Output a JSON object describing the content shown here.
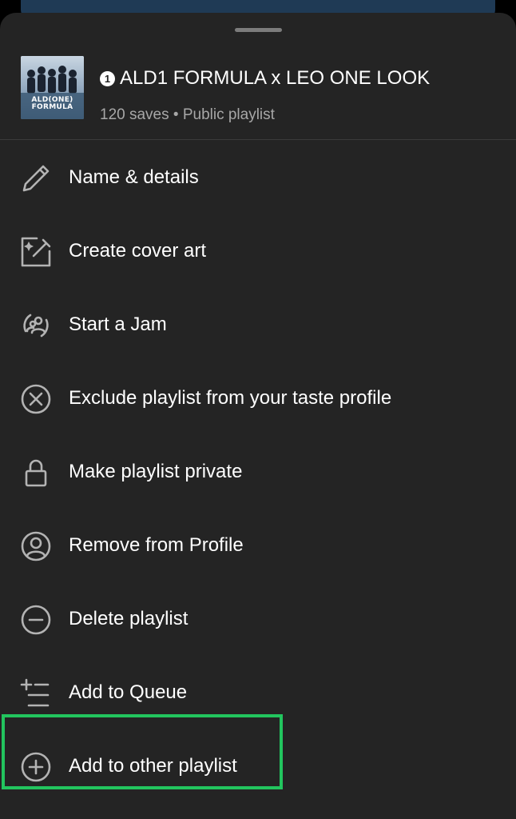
{
  "header": {
    "pin_glyph": "1",
    "title": "ALD1 FORMULA x LEO ONE LOOK",
    "subtitle": "120 saves • Public playlist",
    "cover_text_line1": "ALD(ONE)",
    "cover_text_line2": "FORMULA"
  },
  "menu": {
    "items": [
      {
        "label": "Name & details",
        "icon": "pencil-icon"
      },
      {
        "label": "Create cover art",
        "icon": "cover-art-icon"
      },
      {
        "label": "Start a Jam",
        "icon": "jam-icon"
      },
      {
        "label": "Exclude playlist from your taste profile",
        "icon": "exclude-icon"
      },
      {
        "label": "Make playlist private",
        "icon": "lock-icon"
      },
      {
        "label": "Remove from Profile",
        "icon": "profile-icon"
      },
      {
        "label": "Delete playlist",
        "icon": "minus-circle-icon"
      },
      {
        "label": "Add to Queue",
        "icon": "queue-icon"
      },
      {
        "label": "Add to other playlist",
        "icon": "plus-circle-icon"
      }
    ]
  },
  "colors": {
    "sheet_background": "#242424",
    "text_primary": "#ffffff",
    "text_secondary": "#a7a7a7",
    "highlight": "#22c55e"
  }
}
